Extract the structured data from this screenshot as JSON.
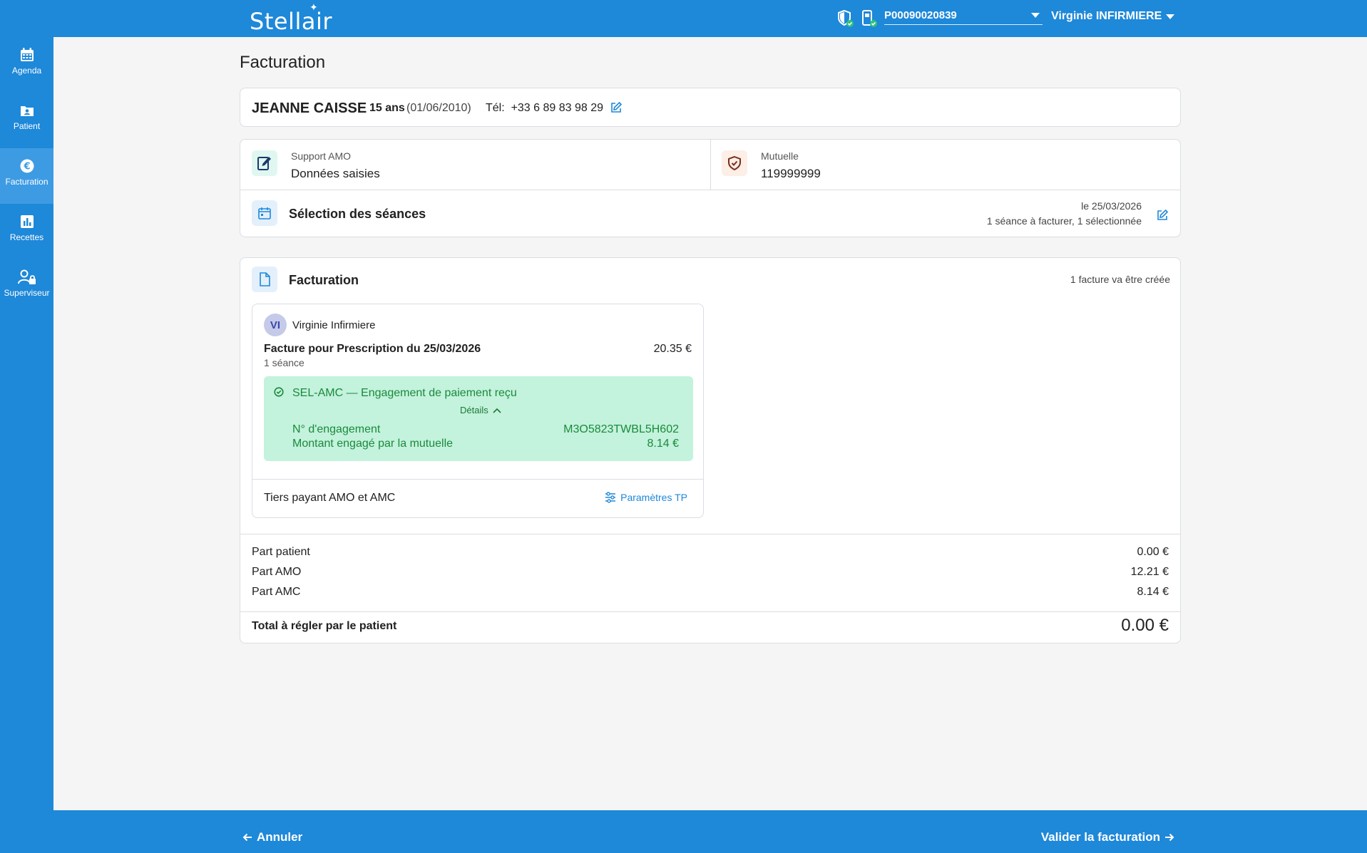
{
  "app": {
    "logo": "Stellair"
  },
  "header": {
    "cps_value": "P00090020839",
    "user_name": "Virginie INFIRMIERE"
  },
  "sidebar": {
    "items": [
      {
        "label": "Agenda",
        "icon": "calendar-icon"
      },
      {
        "label": "Patient",
        "icon": "patient-folder-icon"
      },
      {
        "label": "Facturation",
        "icon": "euro-icon",
        "active": true
      },
      {
        "label": "Recettes",
        "icon": "chart-icon"
      },
      {
        "label": "Superviseur",
        "icon": "user-lock-icon"
      }
    ]
  },
  "page": {
    "title": "Facturation"
  },
  "patient": {
    "name": "JEANNE CAISSE",
    "age": "15 ans",
    "dob": "(01/06/2010)",
    "tel_label": "Tél:",
    "tel": "+33 6 89 83 98 29"
  },
  "support_amo": {
    "label": "Support AMO",
    "value": "Données saisies"
  },
  "mutuelle": {
    "label": "Mutuelle",
    "value": "119999999"
  },
  "seances": {
    "title": "Sélection des séances",
    "date": "le 25/03/2026",
    "count": "1 séance à facturer, 1 sélectionnée"
  },
  "billing": {
    "title": "Facturation",
    "count": "1 facture va être créée",
    "invoice": {
      "avatar": "VI",
      "nurse": "Virginie Infirmiere",
      "title": "Facture pour Prescription du 25/03/2026",
      "amount": "20.35 €",
      "sessions": "1 séance",
      "sel_amc": {
        "title": "SEL-AMC — Engagement de paiement reçu",
        "details_label": "Détails",
        "rows": [
          {
            "label": "N° d'engagement",
            "value": "M3O5823TWBL5H602"
          },
          {
            "label": "Montant engagé par la mutuelle",
            "value": "8.14 €"
          }
        ]
      },
      "tiers_payant": "Tiers payant AMO et AMC",
      "params_label": "Paramètres TP"
    },
    "summary": [
      {
        "label": "Part patient",
        "value": "0.00 €"
      },
      {
        "label": "Part AMO",
        "value": "12.21 €"
      },
      {
        "label": "Part AMC",
        "value": "8.14 €"
      }
    ],
    "total_label": "Total à régler par le patient",
    "total_value": "0.00 €"
  },
  "footer": {
    "cancel_label": "Annuler",
    "validate_label": "Valider la facturation"
  },
  "colors": {
    "primary": "#1e88d9",
    "success_bg": "#c3f2dd",
    "success_text": "#1b8a3a"
  }
}
